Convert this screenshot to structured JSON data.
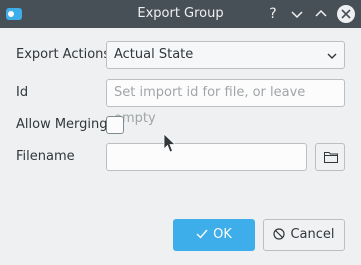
{
  "window": {
    "title": "Export Group",
    "help_glyph": "?"
  },
  "form": {
    "export_actions_label": "Export Actions",
    "export_actions_value": "Actual State",
    "id_label": "Id",
    "id_placeholder": "Set import id for file, or leave empty",
    "allow_merging_label": "Allow Merging",
    "allow_merging_checked": false,
    "filename_label": "Filename",
    "filename_value": ""
  },
  "buttons": {
    "ok_label": "OK",
    "cancel_label": "Cancel"
  },
  "colors": {
    "titlebar": "#475057",
    "accent": "#3daee9",
    "background": "#eff0f1"
  },
  "icons": [
    "app-icon",
    "help-icon",
    "minimize-icon",
    "maximize-icon",
    "close-icon",
    "chevron-down-icon",
    "folder-icon",
    "checkmark-icon",
    "cancel-icon",
    "mouse-cursor-icon"
  ]
}
